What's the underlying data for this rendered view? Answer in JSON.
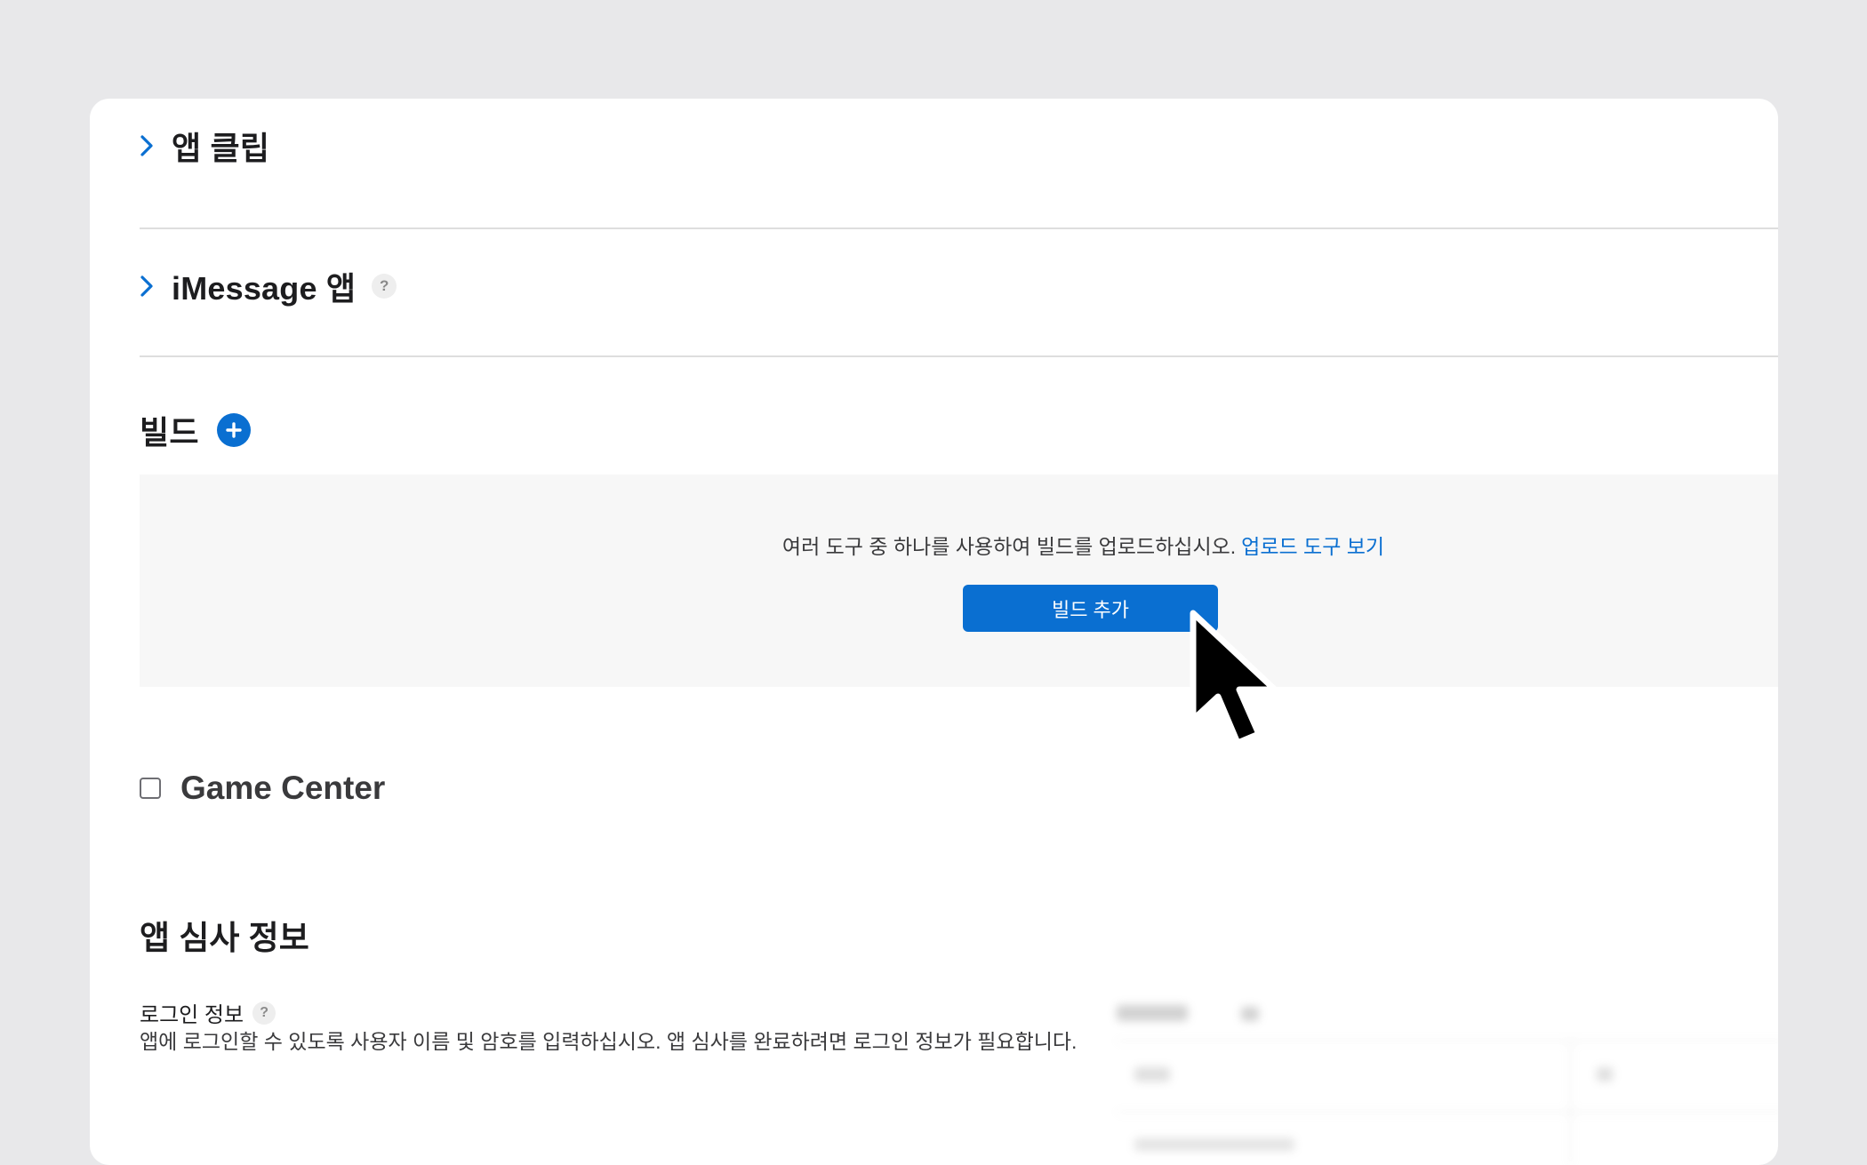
{
  "sections": {
    "app_clips": {
      "title": "앱 클립"
    },
    "imessage": {
      "title": "iMessage 앱",
      "help": "?"
    },
    "builds": {
      "title": "빌드",
      "message": "여러 도구 중 하나를 사용하여 빌드를 업로드하십시오.",
      "link": "업로드 도구 보기",
      "add_button": "빌드 추가"
    },
    "game_center": {
      "label": "Game Center",
      "checked": false
    },
    "review": {
      "title": "앱 심사 정보",
      "login_label": "로그인 정보",
      "login_help": "?",
      "login_desc": "앱에 로그인할 수 있도록 사용자 이름 및 암호를 입력하십시오. 앱 심사를 완료하려면 로그인 정보가 필요합니다."
    }
  },
  "colors": {
    "accent": "#0a6fd1",
    "background": "#e8e8ea",
    "card": "#ffffff"
  },
  "icons": {
    "chevron": "chevron-right-icon",
    "add": "plus-circle-icon",
    "help": "question-mark-icon",
    "cursor": "mouse-pointer-icon"
  }
}
